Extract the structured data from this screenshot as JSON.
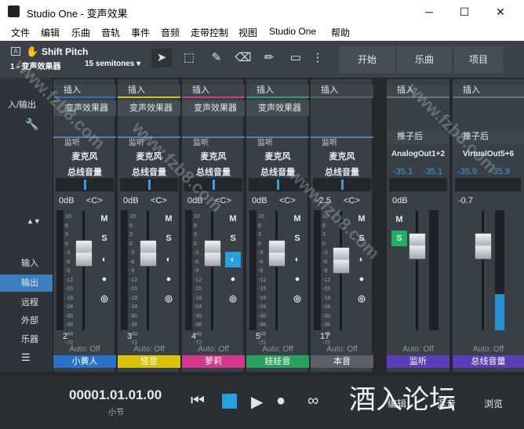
{
  "window": {
    "title": "Studio One - 变声效果",
    "minimize": "─",
    "maximize": "☐",
    "close": "✕"
  },
  "menu": [
    "文件",
    "编辑",
    "乐曲",
    "音轨",
    "事件",
    "音频",
    "走带控制",
    "视图",
    "Studio One",
    "帮助"
  ],
  "toolbar": {
    "tool_name": "Shift Pitch",
    "track_label": "1 - 变声效果器",
    "semitones": "15 semitones ▾",
    "start": "开始",
    "song": "乐曲",
    "project": "项目",
    "a_label": "A"
  },
  "left": {
    "io": "入/输出",
    "input": "输入",
    "output": "输出",
    "remote": "远程",
    "external": "外部",
    "instrument": "乐器"
  },
  "common": {
    "insert": "插入",
    "monitor": "监听",
    "mic": "麦克风",
    "mainout": "总线音量",
    "zero": "0dB",
    "center": "<C>",
    "auto": "Auto: Off",
    "m": "M",
    "s": "S",
    "scale": [
      "10",
      "6",
      "3",
      "0",
      "-3",
      "-6",
      "-9",
      "-12",
      "-15",
      "-18",
      "-24",
      "-30",
      "-36",
      "-48",
      "-72"
    ]
  },
  "channels": [
    {
      "fx": "变声效果器",
      "vol": "0dB",
      "num": "2",
      "name": "小黄人",
      "color": "#2a73c4",
      "fader": 0.69
    },
    {
      "fx": "变声效果器",
      "vol": "0dB",
      "num": "3",
      "name": "怪音",
      "color": "#d8c20c",
      "fader": 0.69
    },
    {
      "fx": "变声效果器",
      "vol": "0dB",
      "num": "4",
      "name": "萝莉",
      "color": "#d2398a",
      "fader": 0.69
    },
    {
      "fx": "变声效果器",
      "vol": "0dB",
      "num": "5",
      "name": "娃娃音",
      "color": "#2aa05e",
      "fader": 0.69
    },
    {
      "fx": "",
      "vol": "-2.5",
      "num": "17",
      "name": "本音",
      "color": "#5e5f6b",
      "fader": 0.61
    }
  ],
  "buses": [
    {
      "send": "推子后",
      "out": "AnalogOut1+2",
      "peakL": "-35.1",
      "peakR": "-35.1",
      "vol": "0dB",
      "name": "监听",
      "color": "#5a3fb8"
    },
    {
      "send": "推子后",
      "out": "VirtualOut5+6",
      "peakL": "-35.9",
      "peakR": "-35.9",
      "vol": "-0.7",
      "name": "总线音量",
      "color": "#5a3fb8"
    }
  ],
  "transport": {
    "time": "00001.01.01.00",
    "unit": "小节",
    "edit": "编辑",
    "mix": "混音",
    "browse": "浏览"
  },
  "watermark": {
    "site": "www.fzb8.com",
    "forum": "酒入论坛"
  }
}
